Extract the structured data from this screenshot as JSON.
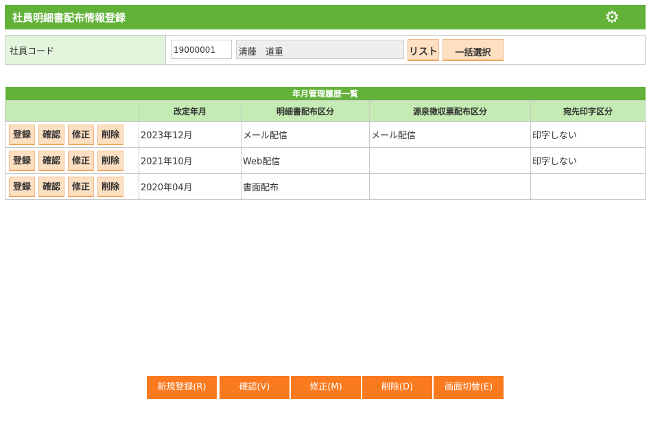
{
  "header": {
    "title": "社員明細書配布情報登録",
    "icon": "gear-icon"
  },
  "employee": {
    "label": "社員コード",
    "code": "19000001",
    "name": "清藤　道重",
    "list_button": "リスト",
    "bulk_button": "一括選択"
  },
  "history": {
    "caption": "年月管理履歴一覧",
    "columns": [
      "",
      "改定年月",
      "明細書配布区分",
      "源泉徴収票配布区分",
      "宛先印字区分"
    ],
    "row_buttons": [
      "登録",
      "確認",
      "修正",
      "削除"
    ],
    "rows": [
      {
        "date": "2023年12月",
        "statement": "メール配信",
        "withholding": "メール配信",
        "print": "印字しない"
      },
      {
        "date": "2021年10月",
        "statement": "Web配信",
        "withholding": "",
        "print": "印字しない"
      },
      {
        "date": "2020年04月",
        "statement": "書面配布",
        "withholding": "",
        "print": ""
      }
    ]
  },
  "footer": {
    "buttons": [
      "新規登録(R)",
      "確認(V)",
      "修正(M)",
      "削除(D)",
      "画面切替(E)"
    ]
  }
}
